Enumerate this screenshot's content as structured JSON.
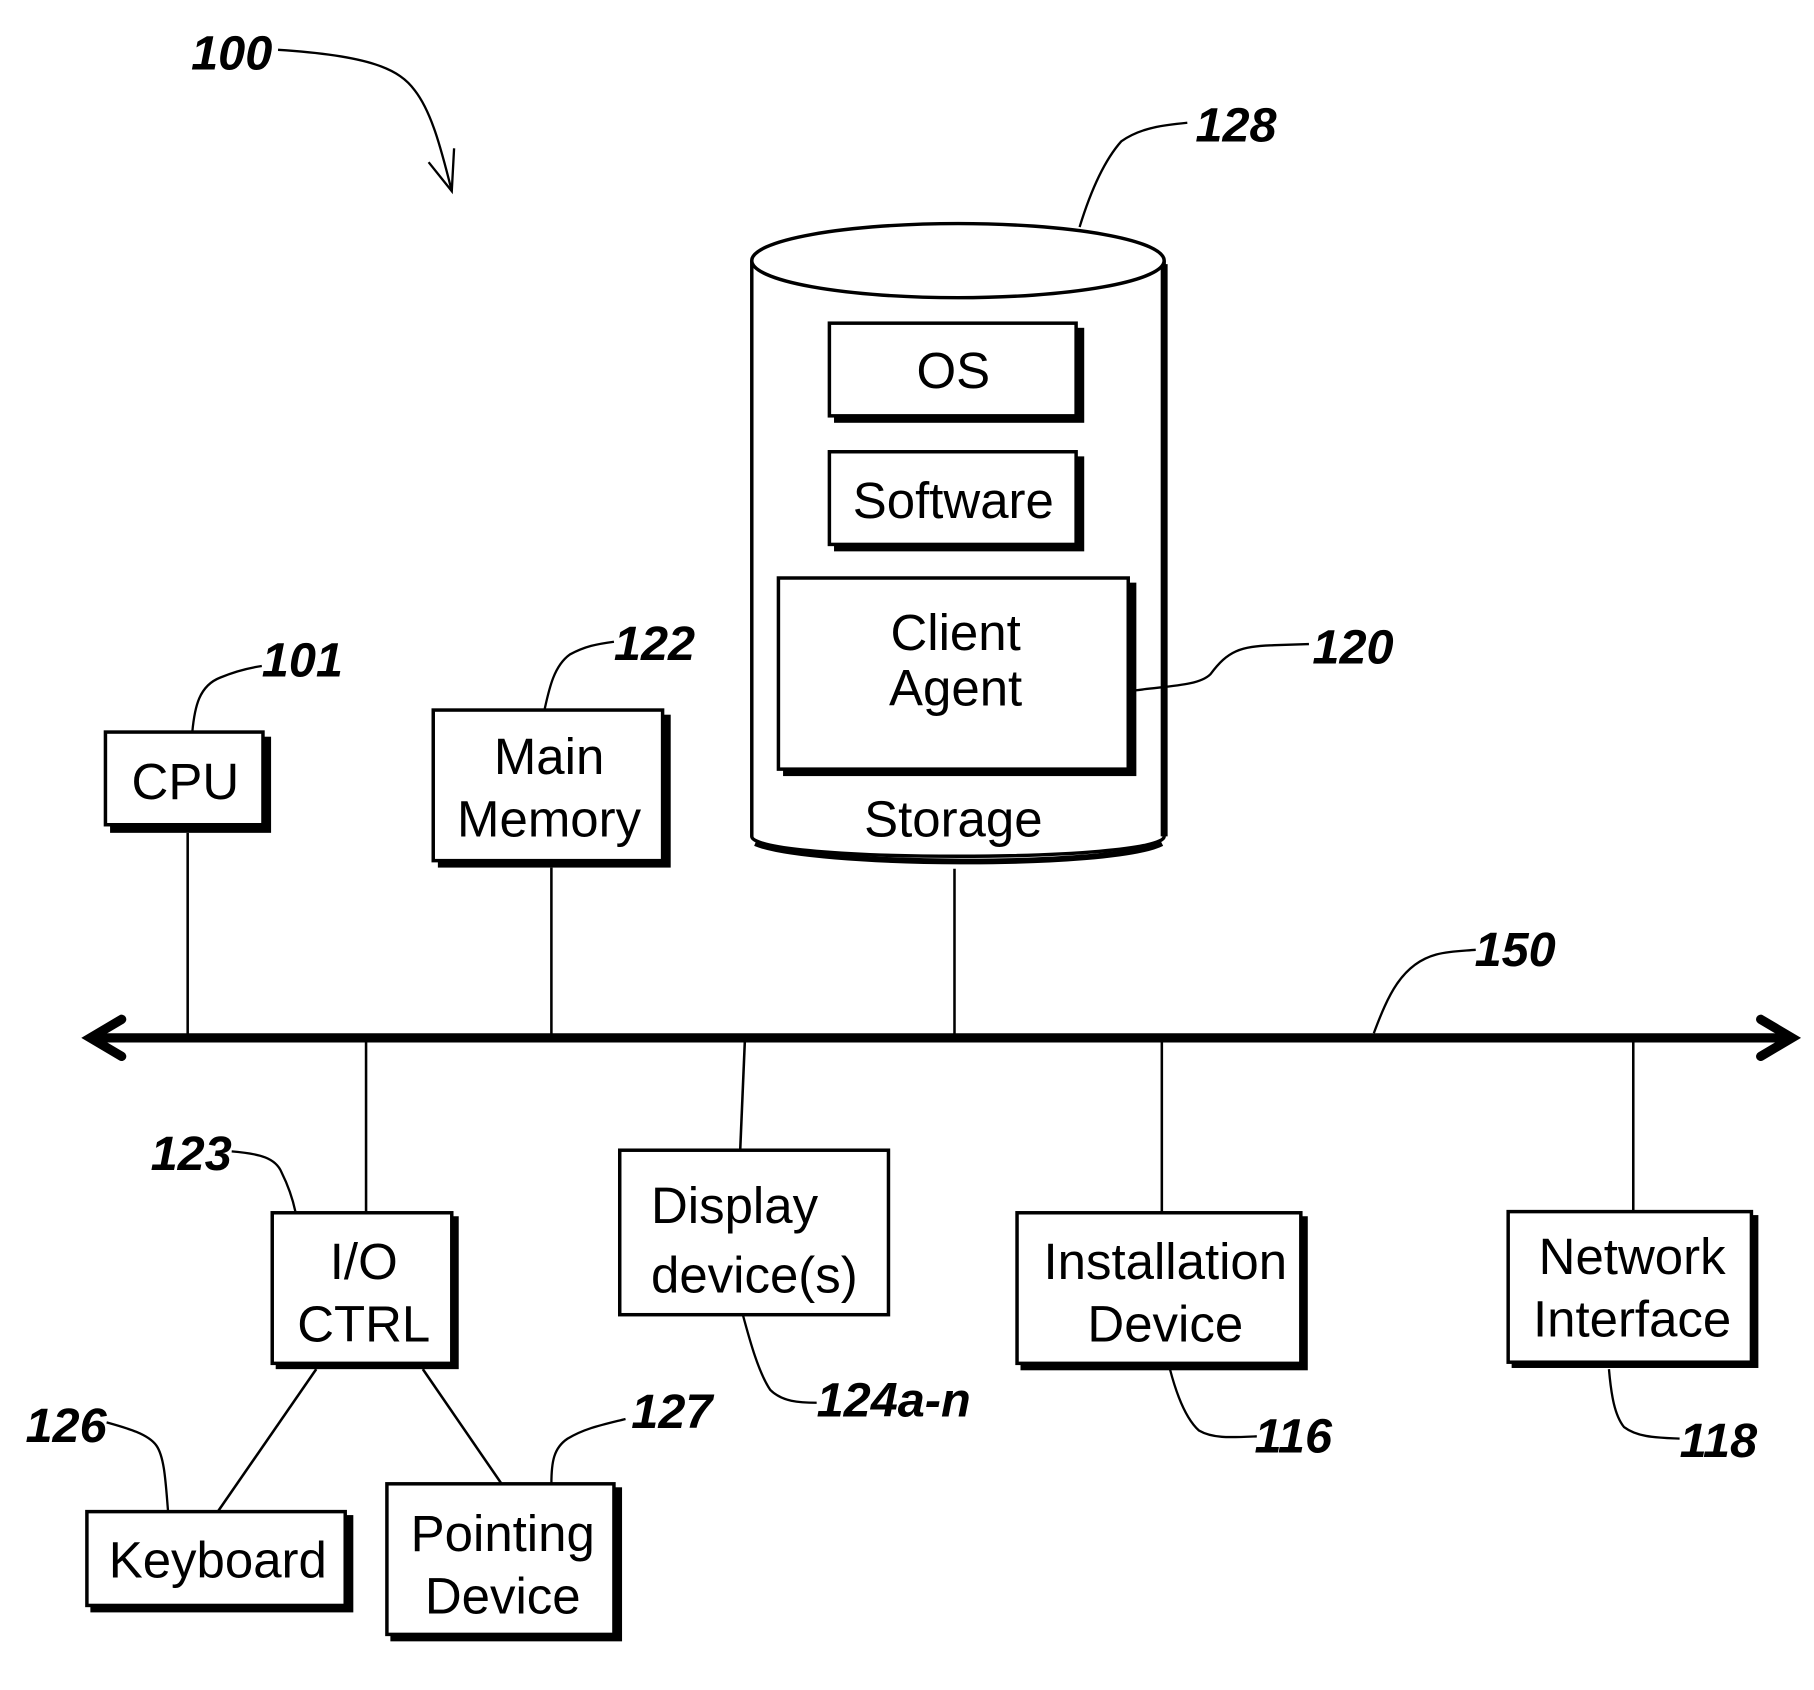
{
  "figure": {
    "reference": "100",
    "bus": {
      "reference": "150"
    },
    "storage": {
      "reference": "128",
      "label": "Storage",
      "contents": [
        {
          "label_lines": [
            "OS"
          ]
        },
        {
          "label_lines": [
            "Software"
          ]
        },
        {
          "label_lines": [
            "Client",
            "Agent"
          ],
          "reference": "120"
        }
      ]
    },
    "components": {
      "cpu": {
        "label_lines": [
          "CPU"
        ],
        "reference": "101"
      },
      "main_memory": {
        "label_lines": [
          "Main",
          "Memory"
        ],
        "reference": "122"
      },
      "io_ctrl": {
        "label_lines": [
          "I/O",
          "CTRL"
        ],
        "reference": "123"
      },
      "display": {
        "label_lines": [
          "Display",
          "device(s)"
        ],
        "reference": "124a-n"
      },
      "installation": {
        "label_lines": [
          "Installation",
          "Device"
        ],
        "reference": "116"
      },
      "network": {
        "label_lines": [
          "Network",
          "Interface"
        ],
        "reference": "118"
      },
      "keyboard": {
        "label_lines": [
          "Keyboard"
        ],
        "reference": "126"
      },
      "pointing": {
        "label_lines": [
          "Pointing",
          "Device"
        ],
        "reference": "127"
      }
    }
  }
}
